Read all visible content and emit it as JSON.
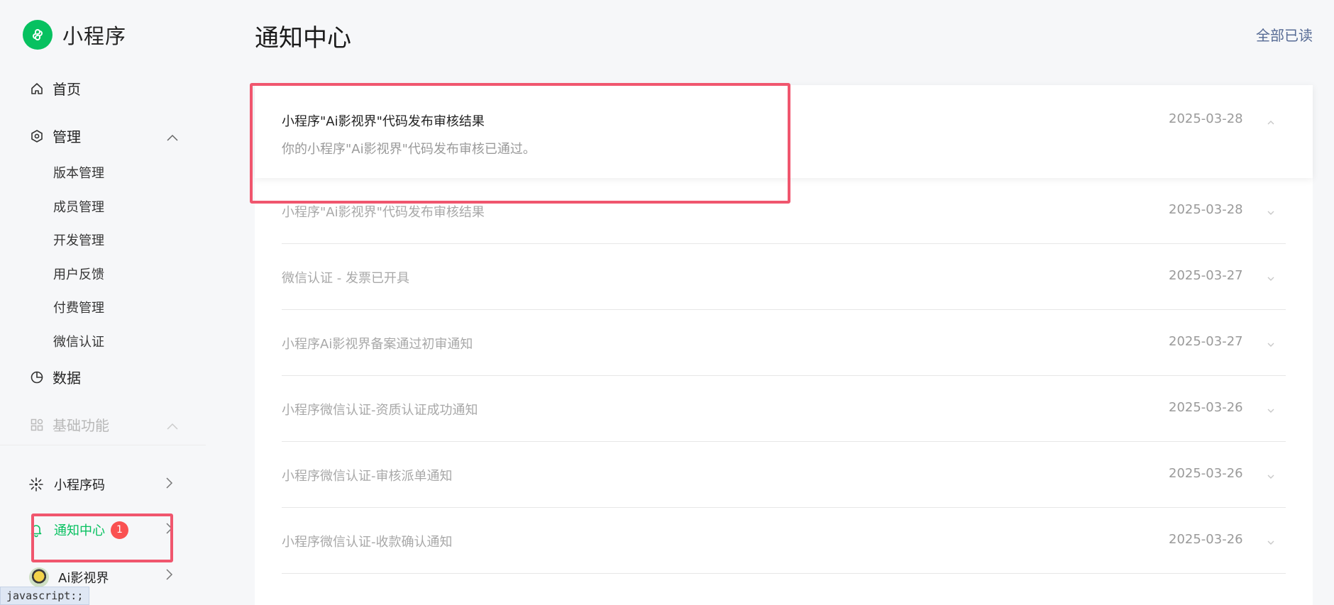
{
  "brand": {
    "name": "小程序",
    "logo_icon": "miniprogram-logo-icon",
    "color": "#07c160"
  },
  "nav": {
    "home": "首页",
    "manage": "管理",
    "manage_sub": [
      "版本管理",
      "成员管理",
      "开发管理",
      "用户反馈",
      "付费管理",
      "微信认证"
    ],
    "data": "数据",
    "basic": "基础功能"
  },
  "bottom_nav": {
    "qrcode": "小程序码",
    "notify": "通知中心",
    "notify_badge": "1",
    "app": "Ai影视界"
  },
  "status_tooltip": "javascript:;",
  "header": {
    "title": "通知中心",
    "mark_all_read": "全部已读"
  },
  "notifications": [
    {
      "title": "小程序\"Ai影视界\"代码发布审核结果",
      "date": "2025-03-28",
      "body": "你的小程序\"Ai影视界\"代码发布审核已通过。",
      "expanded": true
    },
    {
      "title": "小程序\"Ai影视界\"代码发布审核结果",
      "date": "2025-03-28"
    },
    {
      "title": "微信认证 - 发票已开具",
      "date": "2025-03-27"
    },
    {
      "title": "小程序Ai影视界备案通过初审通知",
      "date": "2025-03-27"
    },
    {
      "title": "小程序微信认证-资质认证成功通知",
      "date": "2025-03-26"
    },
    {
      "title": "小程序微信认证-审核派单通知",
      "date": "2025-03-26"
    },
    {
      "title": "小程序微信认证-收款确认通知",
      "date": "2025-03-26"
    }
  ],
  "colors": {
    "accent_green": "#07c160",
    "link": "#576b95",
    "badge_red": "#fa5151",
    "highlight_box": "#f0566e"
  }
}
